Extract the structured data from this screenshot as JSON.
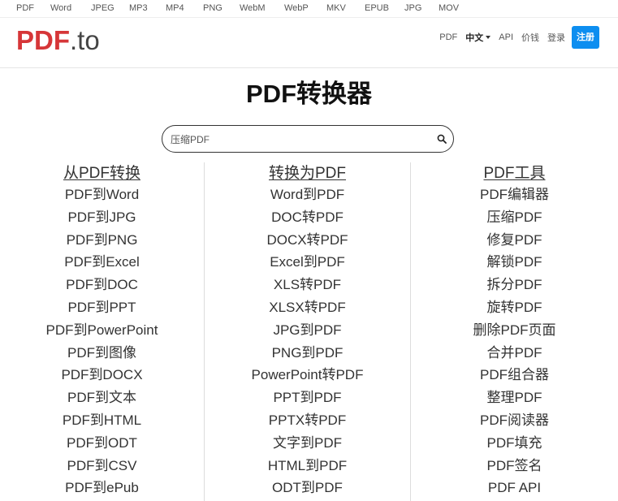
{
  "topnav": [
    "PDF",
    "Word",
    "JPEG",
    "MP3",
    "MP4",
    "PNG",
    "WebM",
    "WebP",
    "MKV",
    "EPUB",
    "JPG",
    "MOV"
  ],
  "logo": {
    "part1": "PDF",
    "part2": ".to"
  },
  "menu": {
    "pdf": "PDF",
    "lang": "中文",
    "api": "API",
    "price": "价钱",
    "login": "登录",
    "signup": "注册"
  },
  "title": "PDF转换器",
  "search": {
    "placeholder": "压缩PDF"
  },
  "columns": [
    {
      "heading": "从PDF转换",
      "items": [
        "PDF到Word",
        "PDF到JPG",
        "PDF到PNG",
        "PDF到Excel",
        "PDF到DOC",
        "PDF到PPT",
        "PDF到PowerPoint",
        "PDF到图像",
        "PDF到DOCX",
        "PDF到文本",
        "PDF到HTML",
        "PDF到ODT",
        "PDF到CSV",
        "PDF到ePub"
      ]
    },
    {
      "heading": "转换为PDF",
      "items": [
        "Word到PDF",
        "DOC转PDF",
        "DOCX转PDF",
        "Excel到PDF",
        "XLS转PDF",
        "XLSX转PDF",
        "JPG到PDF",
        "PNG到PDF",
        "PowerPoint转PDF",
        "PPT到PDF",
        "PPTX转PDF",
        "文字到PDF",
        "HTML到PDF",
        "ODT到PDF"
      ]
    },
    {
      "heading": "PDF工具",
      "items": [
        "PDF编辑器",
        "压缩PDF",
        "修复PDF",
        "解锁PDF",
        "拆分PDF",
        "旋转PDF",
        "删除PDF页面",
        "合并PDF",
        "PDF组合器",
        "整理PDF",
        "PDF阅读器",
        "PDF填充",
        "PDF签名",
        "PDF API"
      ]
    }
  ],
  "colors": {
    "brand": "#d63638",
    "accent": "#0d8ef0"
  }
}
